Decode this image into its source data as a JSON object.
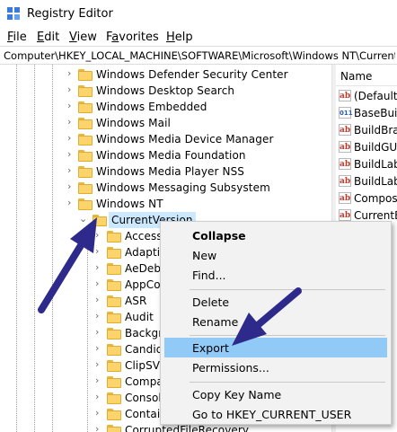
{
  "window": {
    "title": "Registry Editor",
    "icon": "registry-editor-icon"
  },
  "menu": [
    {
      "label": "File",
      "mnemonic": "F",
      "rest": "ile"
    },
    {
      "label": "Edit",
      "mnemonic": "E",
      "rest": "dit"
    },
    {
      "label": "View",
      "mnemonic": "V",
      "rest": "iew"
    },
    {
      "label": "Favorites",
      "mnemonic": "a",
      "pre": "F",
      "rest": "vorites"
    },
    {
      "label": "Help",
      "mnemonic": "H",
      "rest": "elp"
    }
  ],
  "address": {
    "path": "Computer\\HKEY_LOCAL_MACHINE\\SOFTWARE\\Microsoft\\Windows NT\\CurrentVersion"
  },
  "tree": {
    "top_items": [
      "Windows Defender Security Center",
      "Windows Desktop Search",
      "Windows Embedded",
      "Windows Mail",
      "Windows Media Device Manager",
      "Windows Media Foundation",
      "Windows Media Player NSS",
      "Windows Messaging Subsystem",
      "Windows NT"
    ],
    "selected": "CurrentVersion",
    "children": [
      "Accessibility",
      "Adaptive",
      "AeDebug",
      "AppCompat",
      "ASR",
      "Audit",
      "Background",
      "Candidate",
      "ClipSVC",
      "Compatibility",
      "Console",
      "Containers",
      "CorruptedFileRecovery"
    ]
  },
  "values_pane": {
    "header": "Name",
    "items": [
      {
        "name": "(Default)",
        "type": "ab"
      },
      {
        "name": "BaseBuild",
        "type": "bin"
      },
      {
        "name": "BuildBranch",
        "type": "ab"
      },
      {
        "name": "BuildGUID",
        "type": "ab"
      },
      {
        "name": "BuildLab",
        "type": "ab"
      },
      {
        "name": "BuildLabEx",
        "type": "ab"
      },
      {
        "name": "Composition",
        "type": "ab"
      },
      {
        "name": "CurrentBuild",
        "type": "ab"
      }
    ]
  },
  "context_menu": {
    "items": {
      "collapse": "Collapse",
      "new": "New",
      "find": "Find...",
      "delete": "Delete",
      "rename": "Rename",
      "export": "Export",
      "permissions": "Permissions...",
      "copy_key_name": "Copy Key Name",
      "goto": "Go to HKEY_CURRENT_USER"
    },
    "highlighted": "Export"
  },
  "colors": {
    "selection": "#cce8ff",
    "menu_highlight": "#91c9f7",
    "annotation_arrow": "#2e2a8c",
    "folder": "#fcd46b"
  }
}
